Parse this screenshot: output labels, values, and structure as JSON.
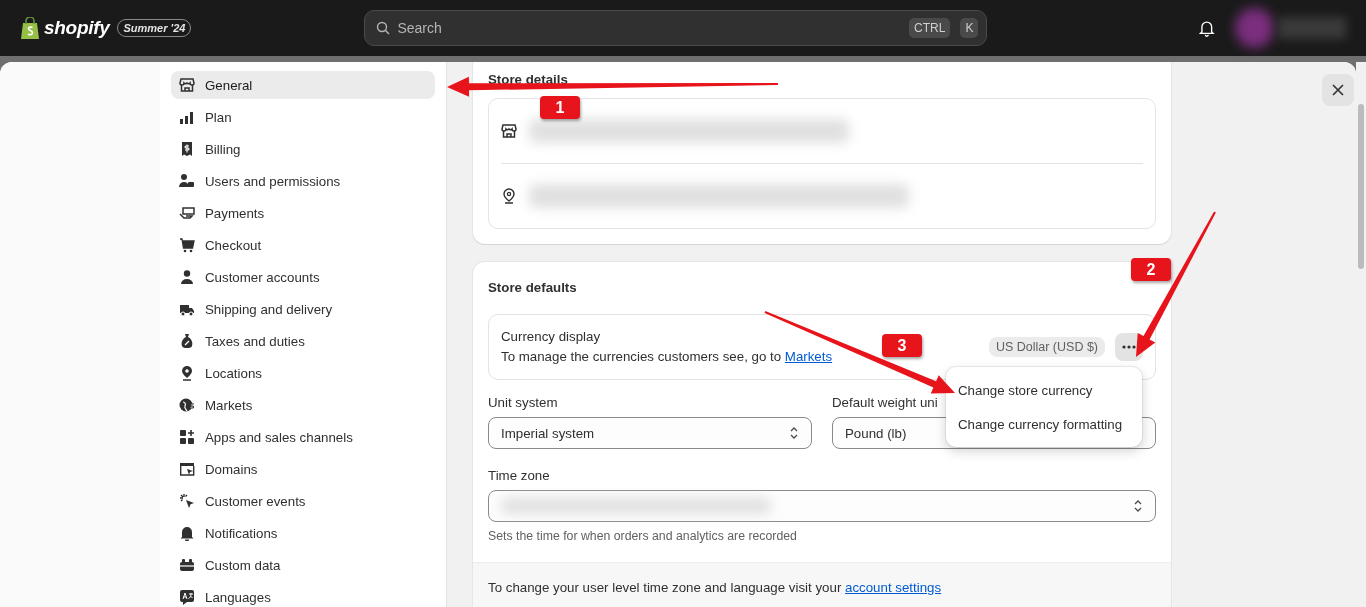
{
  "topbar": {
    "logo": "shopify",
    "edition_badge": "Summer '24",
    "search": {
      "placeholder": "Search",
      "shortcut_keys": [
        "CTRL",
        "K"
      ]
    }
  },
  "sidebar": {
    "items": [
      {
        "label": "General",
        "selected": true
      },
      {
        "label": "Plan",
        "selected": false
      },
      {
        "label": "Billing",
        "selected": false
      },
      {
        "label": "Users and permissions",
        "selected": false
      },
      {
        "label": "Payments",
        "selected": false
      },
      {
        "label": "Checkout",
        "selected": false
      },
      {
        "label": "Customer accounts",
        "selected": false
      },
      {
        "label": "Shipping and delivery",
        "selected": false
      },
      {
        "label": "Taxes and duties",
        "selected": false
      },
      {
        "label": "Locations",
        "selected": false
      },
      {
        "label": "Markets",
        "selected": false
      },
      {
        "label": "Apps and sales channels",
        "selected": false
      },
      {
        "label": "Domains",
        "selected": false
      },
      {
        "label": "Customer events",
        "selected": false
      },
      {
        "label": "Notifications",
        "selected": false
      },
      {
        "label": "Custom data",
        "selected": false
      },
      {
        "label": "Languages",
        "selected": false
      }
    ]
  },
  "store_details": {
    "title": "Store details"
  },
  "store_defaults": {
    "title": "Store defaults",
    "currency": {
      "label": "Currency display",
      "description": "To manage the currencies customers see, go to ",
      "link": "Markets",
      "value": "US Dollar (USD $)"
    },
    "menu": [
      {
        "label": "Change store currency"
      },
      {
        "label": "Change currency formatting"
      }
    ],
    "unit_system": {
      "label": "Unit system",
      "value": "Imperial system"
    },
    "weight_unit": {
      "label": "Default weight uni",
      "value": "Pound (lb)"
    },
    "time_zone": {
      "label": "Time zone",
      "help": "Sets the time for when orders and analytics are recorded"
    },
    "footer": {
      "text": "To change your user level time zone and language visit your ",
      "link": "account settings"
    }
  },
  "annotations": [
    {
      "label": "1"
    },
    {
      "label": "2"
    },
    {
      "label": "3"
    }
  ]
}
